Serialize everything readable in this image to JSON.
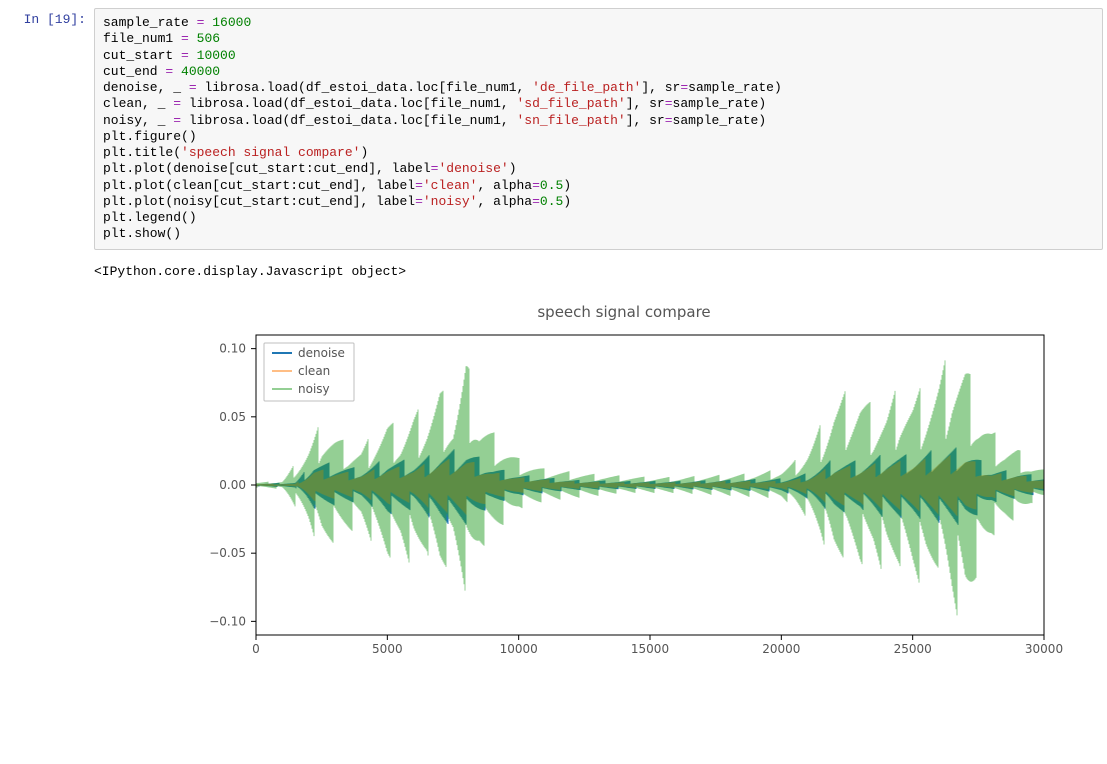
{
  "cell": {
    "prompt": "In [19]:",
    "code": [
      {
        "t": [
          {
            "c": "nm",
            "v": "sample_rate "
          },
          {
            "c": "op",
            "v": "="
          },
          {
            "c": "nm",
            "v": " "
          },
          {
            "c": "num",
            "v": "16000"
          }
        ]
      },
      {
        "t": [
          {
            "c": "nm",
            "v": "file_num1 "
          },
          {
            "c": "op",
            "v": "="
          },
          {
            "c": "nm",
            "v": " "
          },
          {
            "c": "num",
            "v": "506"
          }
        ]
      },
      {
        "t": [
          {
            "c": "nm",
            "v": "cut_start "
          },
          {
            "c": "op",
            "v": "="
          },
          {
            "c": "nm",
            "v": " "
          },
          {
            "c": "num",
            "v": "10000"
          }
        ]
      },
      {
        "t": [
          {
            "c": "nm",
            "v": "cut_end "
          },
          {
            "c": "op",
            "v": "="
          },
          {
            "c": "nm",
            "v": " "
          },
          {
            "c": "num",
            "v": "40000"
          }
        ]
      },
      {
        "t": [
          {
            "c": "nm",
            "v": "denoise, _ "
          },
          {
            "c": "op",
            "v": "="
          },
          {
            "c": "nm",
            "v": " librosa.load(df_estoi_data.loc[file_num1, "
          },
          {
            "c": "st",
            "v": "'de_file_path'"
          },
          {
            "c": "nm",
            "v": "], sr"
          },
          {
            "c": "op",
            "v": "="
          },
          {
            "c": "nm",
            "v": "sample_rate)"
          }
        ]
      },
      {
        "t": [
          {
            "c": "nm",
            "v": "clean, _ "
          },
          {
            "c": "op",
            "v": "="
          },
          {
            "c": "nm",
            "v": " librosa.load(df_estoi_data.loc[file_num1, "
          },
          {
            "c": "st",
            "v": "'sd_file_path'"
          },
          {
            "c": "nm",
            "v": "], sr"
          },
          {
            "c": "op",
            "v": "="
          },
          {
            "c": "nm",
            "v": "sample_rate)"
          }
        ]
      },
      {
        "t": [
          {
            "c": "nm",
            "v": "noisy, _ "
          },
          {
            "c": "op",
            "v": "="
          },
          {
            "c": "nm",
            "v": " librosa.load(df_estoi_data.loc[file_num1, "
          },
          {
            "c": "st",
            "v": "'sn_file_path'"
          },
          {
            "c": "nm",
            "v": "], sr"
          },
          {
            "c": "op",
            "v": "="
          },
          {
            "c": "nm",
            "v": "sample_rate)"
          }
        ]
      },
      {
        "t": [
          {
            "c": "nm",
            "v": "plt.figure()"
          }
        ]
      },
      {
        "t": [
          {
            "c": "nm",
            "v": "plt.title("
          },
          {
            "c": "st",
            "v": "'speech signal compare'"
          },
          {
            "c": "nm",
            "v": ")"
          }
        ]
      },
      {
        "t": [
          {
            "c": "nm",
            "v": "plt.plot(denoise[cut_start:cut_end], label"
          },
          {
            "c": "op",
            "v": "="
          },
          {
            "c": "st",
            "v": "'denoise'"
          },
          {
            "c": "nm",
            "v": ")"
          }
        ]
      },
      {
        "t": [
          {
            "c": "nm",
            "v": "plt.plot(clean[cut_start:cut_end], label"
          },
          {
            "c": "op",
            "v": "="
          },
          {
            "c": "st",
            "v": "'clean'"
          },
          {
            "c": "nm",
            "v": ", alpha"
          },
          {
            "c": "op",
            "v": "="
          },
          {
            "c": "num",
            "v": "0.5"
          },
          {
            "c": "nm",
            "v": ")"
          }
        ]
      },
      {
        "t": [
          {
            "c": "nm",
            "v": "plt.plot(noisy[cut_start:cut_end], label"
          },
          {
            "c": "op",
            "v": "="
          },
          {
            "c": "st",
            "v": "'noisy'"
          },
          {
            "c": "nm",
            "v": ", alpha"
          },
          {
            "c": "op",
            "v": "="
          },
          {
            "c": "num",
            "v": "0.5"
          },
          {
            "c": "nm",
            "v": ")"
          }
        ]
      },
      {
        "t": [
          {
            "c": "nm",
            "v": "plt.legend()"
          }
        ]
      },
      {
        "t": [
          {
            "c": "nm",
            "v": "plt.show()"
          }
        ]
      }
    ]
  },
  "output": {
    "stdout": "<IPython.core.display.Javascript object>"
  },
  "chart_data": {
    "type": "line",
    "title": "speech signal compare",
    "xlabel": "",
    "ylabel": "",
    "xlim": [
      0,
      30000
    ],
    "ylim": [
      -0.11,
      0.11
    ],
    "xticks": [
      0,
      5000,
      10000,
      15000,
      20000,
      25000,
      30000
    ],
    "yticks": [
      -0.1,
      -0.05,
      0.0,
      0.05,
      0.1
    ],
    "ytick_labels": [
      "−0.10",
      "−0.05",
      "0.00",
      "0.05",
      "0.10"
    ],
    "legend_position": "upper left",
    "series": [
      {
        "name": "denoise",
        "color": "#1f77b4",
        "alpha": 1.0,
        "envelope": [
          {
            "x": 0,
            "lo": -0.001,
            "hi": 0.001
          },
          {
            "x": 1500,
            "lo": -0.002,
            "hi": 0.002
          },
          {
            "x": 2200,
            "lo": -0.018,
            "hi": 0.018
          },
          {
            "x": 3000,
            "lo": -0.015,
            "hi": 0.016
          },
          {
            "x": 4000,
            "lo": -0.012,
            "hi": 0.012
          },
          {
            "x": 5000,
            "lo": -0.022,
            "hi": 0.02
          },
          {
            "x": 6000,
            "lo": -0.018,
            "hi": 0.018
          },
          {
            "x": 7000,
            "lo": -0.028,
            "hi": 0.025
          },
          {
            "x": 8000,
            "lo": -0.03,
            "hi": 0.028
          },
          {
            "x": 9000,
            "lo": -0.015,
            "hi": 0.014
          },
          {
            "x": 10000,
            "lo": -0.008,
            "hi": 0.008
          },
          {
            "x": 12000,
            "lo": -0.004,
            "hi": 0.004
          },
          {
            "x": 14000,
            "lo": -0.003,
            "hi": 0.003
          },
          {
            "x": 16000,
            "lo": -0.003,
            "hi": 0.003
          },
          {
            "x": 18000,
            "lo": -0.004,
            "hi": 0.004
          },
          {
            "x": 20000,
            "lo": -0.005,
            "hi": 0.005
          },
          {
            "x": 21000,
            "lo": -0.01,
            "hi": 0.009
          },
          {
            "x": 22000,
            "lo": -0.022,
            "hi": 0.02
          },
          {
            "x": 23000,
            "lo": -0.018,
            "hi": 0.018
          },
          {
            "x": 24000,
            "lo": -0.025,
            "hi": 0.024
          },
          {
            "x": 25000,
            "lo": -0.024,
            "hi": 0.022
          },
          {
            "x": 26000,
            "lo": -0.028,
            "hi": 0.027
          },
          {
            "x": 27000,
            "lo": -0.03,
            "hi": 0.028
          },
          {
            "x": 28000,
            "lo": -0.013,
            "hi": 0.012
          },
          {
            "x": 29000,
            "lo": -0.01,
            "hi": 0.01
          },
          {
            "x": 30000,
            "lo": -0.006,
            "hi": 0.006
          }
        ]
      },
      {
        "name": "clean",
        "color": "#ff7f0e",
        "alpha": 0.5,
        "envelope": [
          {
            "x": 0,
            "lo": -0.001,
            "hi": 0.001
          },
          {
            "x": 1500,
            "lo": -0.001,
            "hi": 0.001
          },
          {
            "x": 2200,
            "lo": -0.012,
            "hi": 0.012
          },
          {
            "x": 3000,
            "lo": -0.01,
            "hi": 0.011
          },
          {
            "x": 4000,
            "lo": -0.009,
            "hi": 0.009
          },
          {
            "x": 5000,
            "lo": -0.015,
            "hi": 0.014
          },
          {
            "x": 6000,
            "lo": -0.013,
            "hi": 0.013
          },
          {
            "x": 7000,
            "lo": -0.02,
            "hi": 0.019
          },
          {
            "x": 8000,
            "lo": -0.022,
            "hi": 0.02
          },
          {
            "x": 9000,
            "lo": -0.011,
            "hi": 0.01
          },
          {
            "x": 10000,
            "lo": -0.006,
            "hi": 0.006
          },
          {
            "x": 12000,
            "lo": -0.003,
            "hi": 0.003
          },
          {
            "x": 14000,
            "lo": -0.002,
            "hi": 0.002
          },
          {
            "x": 16000,
            "lo": -0.002,
            "hi": 0.002
          },
          {
            "x": 18000,
            "lo": -0.003,
            "hi": 0.003
          },
          {
            "x": 20000,
            "lo": -0.003,
            "hi": 0.003
          },
          {
            "x": 21000,
            "lo": -0.007,
            "hi": 0.006
          },
          {
            "x": 22000,
            "lo": -0.016,
            "hi": 0.015
          },
          {
            "x": 23000,
            "lo": -0.014,
            "hi": 0.014
          },
          {
            "x": 24000,
            "lo": -0.019,
            "hi": 0.018
          },
          {
            "x": 25000,
            "lo": -0.019,
            "hi": 0.018
          },
          {
            "x": 26000,
            "lo": -0.022,
            "hi": 0.022
          },
          {
            "x": 27000,
            "lo": -0.024,
            "hi": 0.023
          },
          {
            "x": 28000,
            "lo": -0.01,
            "hi": 0.009
          },
          {
            "x": 29000,
            "lo": -0.008,
            "hi": 0.008
          },
          {
            "x": 30000,
            "lo": -0.004,
            "hi": 0.004
          }
        ]
      },
      {
        "name": "noisy",
        "color": "#2ca02c",
        "alpha": 0.5,
        "envelope": [
          {
            "x": 0,
            "lo": -0.002,
            "hi": 0.002
          },
          {
            "x": 1000,
            "lo": -0.003,
            "hi": 0.003
          },
          {
            "x": 2000,
            "lo": -0.03,
            "hi": 0.03
          },
          {
            "x": 2500,
            "lo": -0.05,
            "hi": 0.048
          },
          {
            "x": 3000,
            "lo": -0.042,
            "hi": 0.04
          },
          {
            "x": 3500,
            "lo": -0.036,
            "hi": 0.03
          },
          {
            "x": 4000,
            "lo": -0.03,
            "hi": 0.028
          },
          {
            "x": 4500,
            "lo": -0.045,
            "hi": 0.04
          },
          {
            "x": 5000,
            "lo": -0.055,
            "hi": 0.05
          },
          {
            "x": 5500,
            "lo": -0.048,
            "hi": 0.042
          },
          {
            "x": 6000,
            "lo": -0.062,
            "hi": 0.055
          },
          {
            "x": 6500,
            "lo": -0.05,
            "hi": 0.06
          },
          {
            "x": 7000,
            "lo": -0.068,
            "hi": 0.075
          },
          {
            "x": 7500,
            "lo": -0.055,
            "hi": 0.058
          },
          {
            "x": 8000,
            "lo": -0.082,
            "hi": 0.095
          },
          {
            "x": 8500,
            "lo": -0.05,
            "hi": 0.052
          },
          {
            "x": 9000,
            "lo": -0.038,
            "hi": 0.04
          },
          {
            "x": 9500,
            "lo": -0.028,
            "hi": 0.03
          },
          {
            "x": 10000,
            "lo": -0.018,
            "hi": 0.02
          },
          {
            "x": 11000,
            "lo": -0.012,
            "hi": 0.012
          },
          {
            "x": 12000,
            "lo": -0.01,
            "hi": 0.01
          },
          {
            "x": 13000,
            "lo": -0.008,
            "hi": 0.008
          },
          {
            "x": 14000,
            "lo": -0.006,
            "hi": 0.007
          },
          {
            "x": 15000,
            "lo": -0.006,
            "hi": 0.006
          },
          {
            "x": 16000,
            "lo": -0.006,
            "hi": 0.006
          },
          {
            "x": 17000,
            "lo": -0.007,
            "hi": 0.007
          },
          {
            "x": 18000,
            "lo": -0.008,
            "hi": 0.008
          },
          {
            "x": 19000,
            "lo": -0.009,
            "hi": 0.009
          },
          {
            "x": 20000,
            "lo": -0.01,
            "hi": 0.012
          },
          {
            "x": 20500,
            "lo": -0.016,
            "hi": 0.018
          },
          {
            "x": 21000,
            "lo": -0.025,
            "hi": 0.028
          },
          {
            "x": 21500,
            "lo": -0.04,
            "hi": 0.045
          },
          {
            "x": 22000,
            "lo": -0.06,
            "hi": 0.065
          },
          {
            "x": 22500,
            "lo": -0.052,
            "hi": 0.07
          },
          {
            "x": 23000,
            "lo": -0.06,
            "hi": 0.072
          },
          {
            "x": 23500,
            "lo": -0.055,
            "hi": 0.058
          },
          {
            "x": 24000,
            "lo": -0.068,
            "hi": 0.06
          },
          {
            "x": 24500,
            "lo": -0.06,
            "hi": 0.075
          },
          {
            "x": 25000,
            "lo": -0.07,
            "hi": 0.068
          },
          {
            "x": 25500,
            "lo": -0.075,
            "hi": 0.075
          },
          {
            "x": 26000,
            "lo": -0.06,
            "hi": 0.085
          },
          {
            "x": 26500,
            "lo": -0.09,
            "hi": 0.102
          },
          {
            "x": 27000,
            "lo": -0.106,
            "hi": 0.095
          },
          {
            "x": 27500,
            "lo": -0.06,
            "hi": 0.062
          },
          {
            "x": 28000,
            "lo": -0.04,
            "hi": 0.042
          },
          {
            "x": 28500,
            "lo": -0.03,
            "hi": 0.032
          },
          {
            "x": 29000,
            "lo": -0.025,
            "hi": 0.028
          },
          {
            "x": 29500,
            "lo": -0.014,
            "hi": 0.016
          },
          {
            "x": 30000,
            "lo": -0.01,
            "hi": 0.012
          }
        ]
      }
    ]
  },
  "colors": {
    "denoise": "#1f77b4",
    "clean": "#ff7f0e",
    "noisy": "#2ca02c"
  }
}
